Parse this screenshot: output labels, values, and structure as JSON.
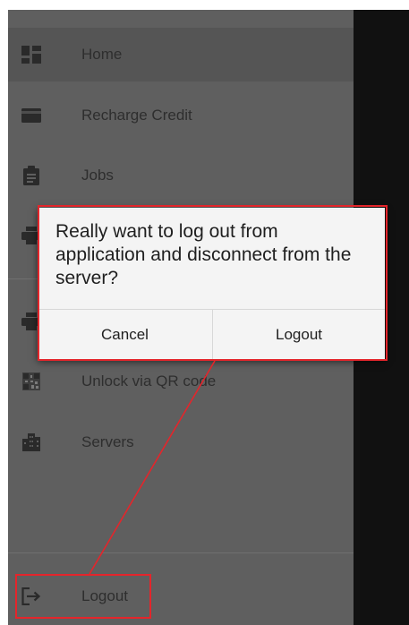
{
  "drawer": {
    "items": [
      {
        "label": "Home",
        "icon": "dashboard-icon"
      },
      {
        "label": "Recharge Credit",
        "icon": "credit-card-icon"
      },
      {
        "label": "Jobs",
        "icon": "clipboard-icon"
      },
      {
        "label": "",
        "icon": "printer-icon"
      },
      {
        "label": "",
        "icon": "printer-icon"
      },
      {
        "label": "Unlock via QR code",
        "icon": "qr-code-icon"
      },
      {
        "label": "Servers",
        "icon": "building-icon"
      },
      {
        "label": "Logout",
        "icon": "logout-icon"
      }
    ]
  },
  "dialog": {
    "message": "Really want to log out from application and disconnect from the server?",
    "cancel_label": "Cancel",
    "confirm_label": "Logout"
  },
  "colors": {
    "highlight": "#e4252b",
    "drawer_bg": "#5f5f5f",
    "dialog_bg": "#f4f4f4"
  }
}
